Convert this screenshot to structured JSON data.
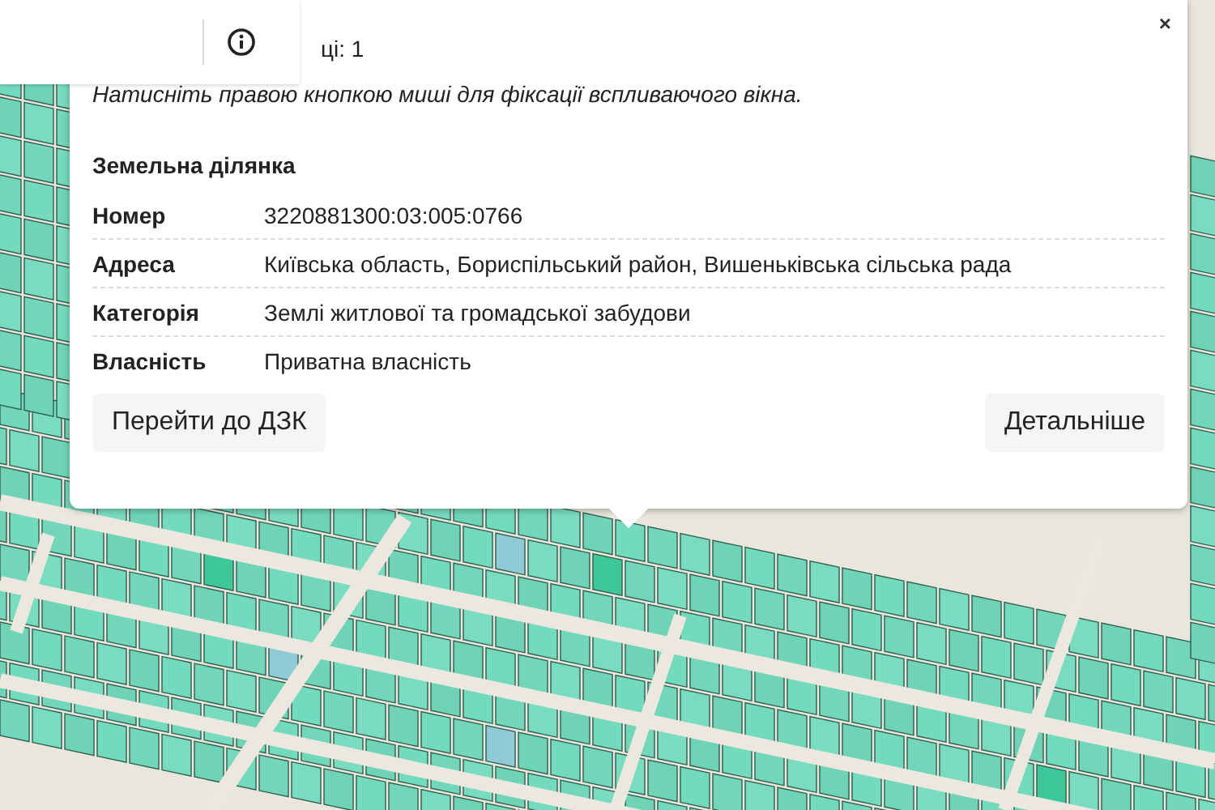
{
  "popup": {
    "counter": "ці: 1",
    "hint": "Натисніть правою кнопкою миші для фіксації вспливаючого вікна.",
    "close": "×",
    "title": "Земельна ділянка",
    "rows": [
      {
        "label": "Номер",
        "value": "3220881300:03:005:0766"
      },
      {
        "label": "Адреса",
        "value": "Київська область, Бориспільський район, Вишеньківська сільська рада"
      },
      {
        "label": "Категорія",
        "value": "Землі житлової та громадської забудови"
      },
      {
        "label": "Власність",
        "value": "Приватна власність"
      }
    ],
    "buttons": [
      {
        "label": "Перейти до ДЗК"
      },
      {
        "label": "Детальніше"
      }
    ]
  }
}
